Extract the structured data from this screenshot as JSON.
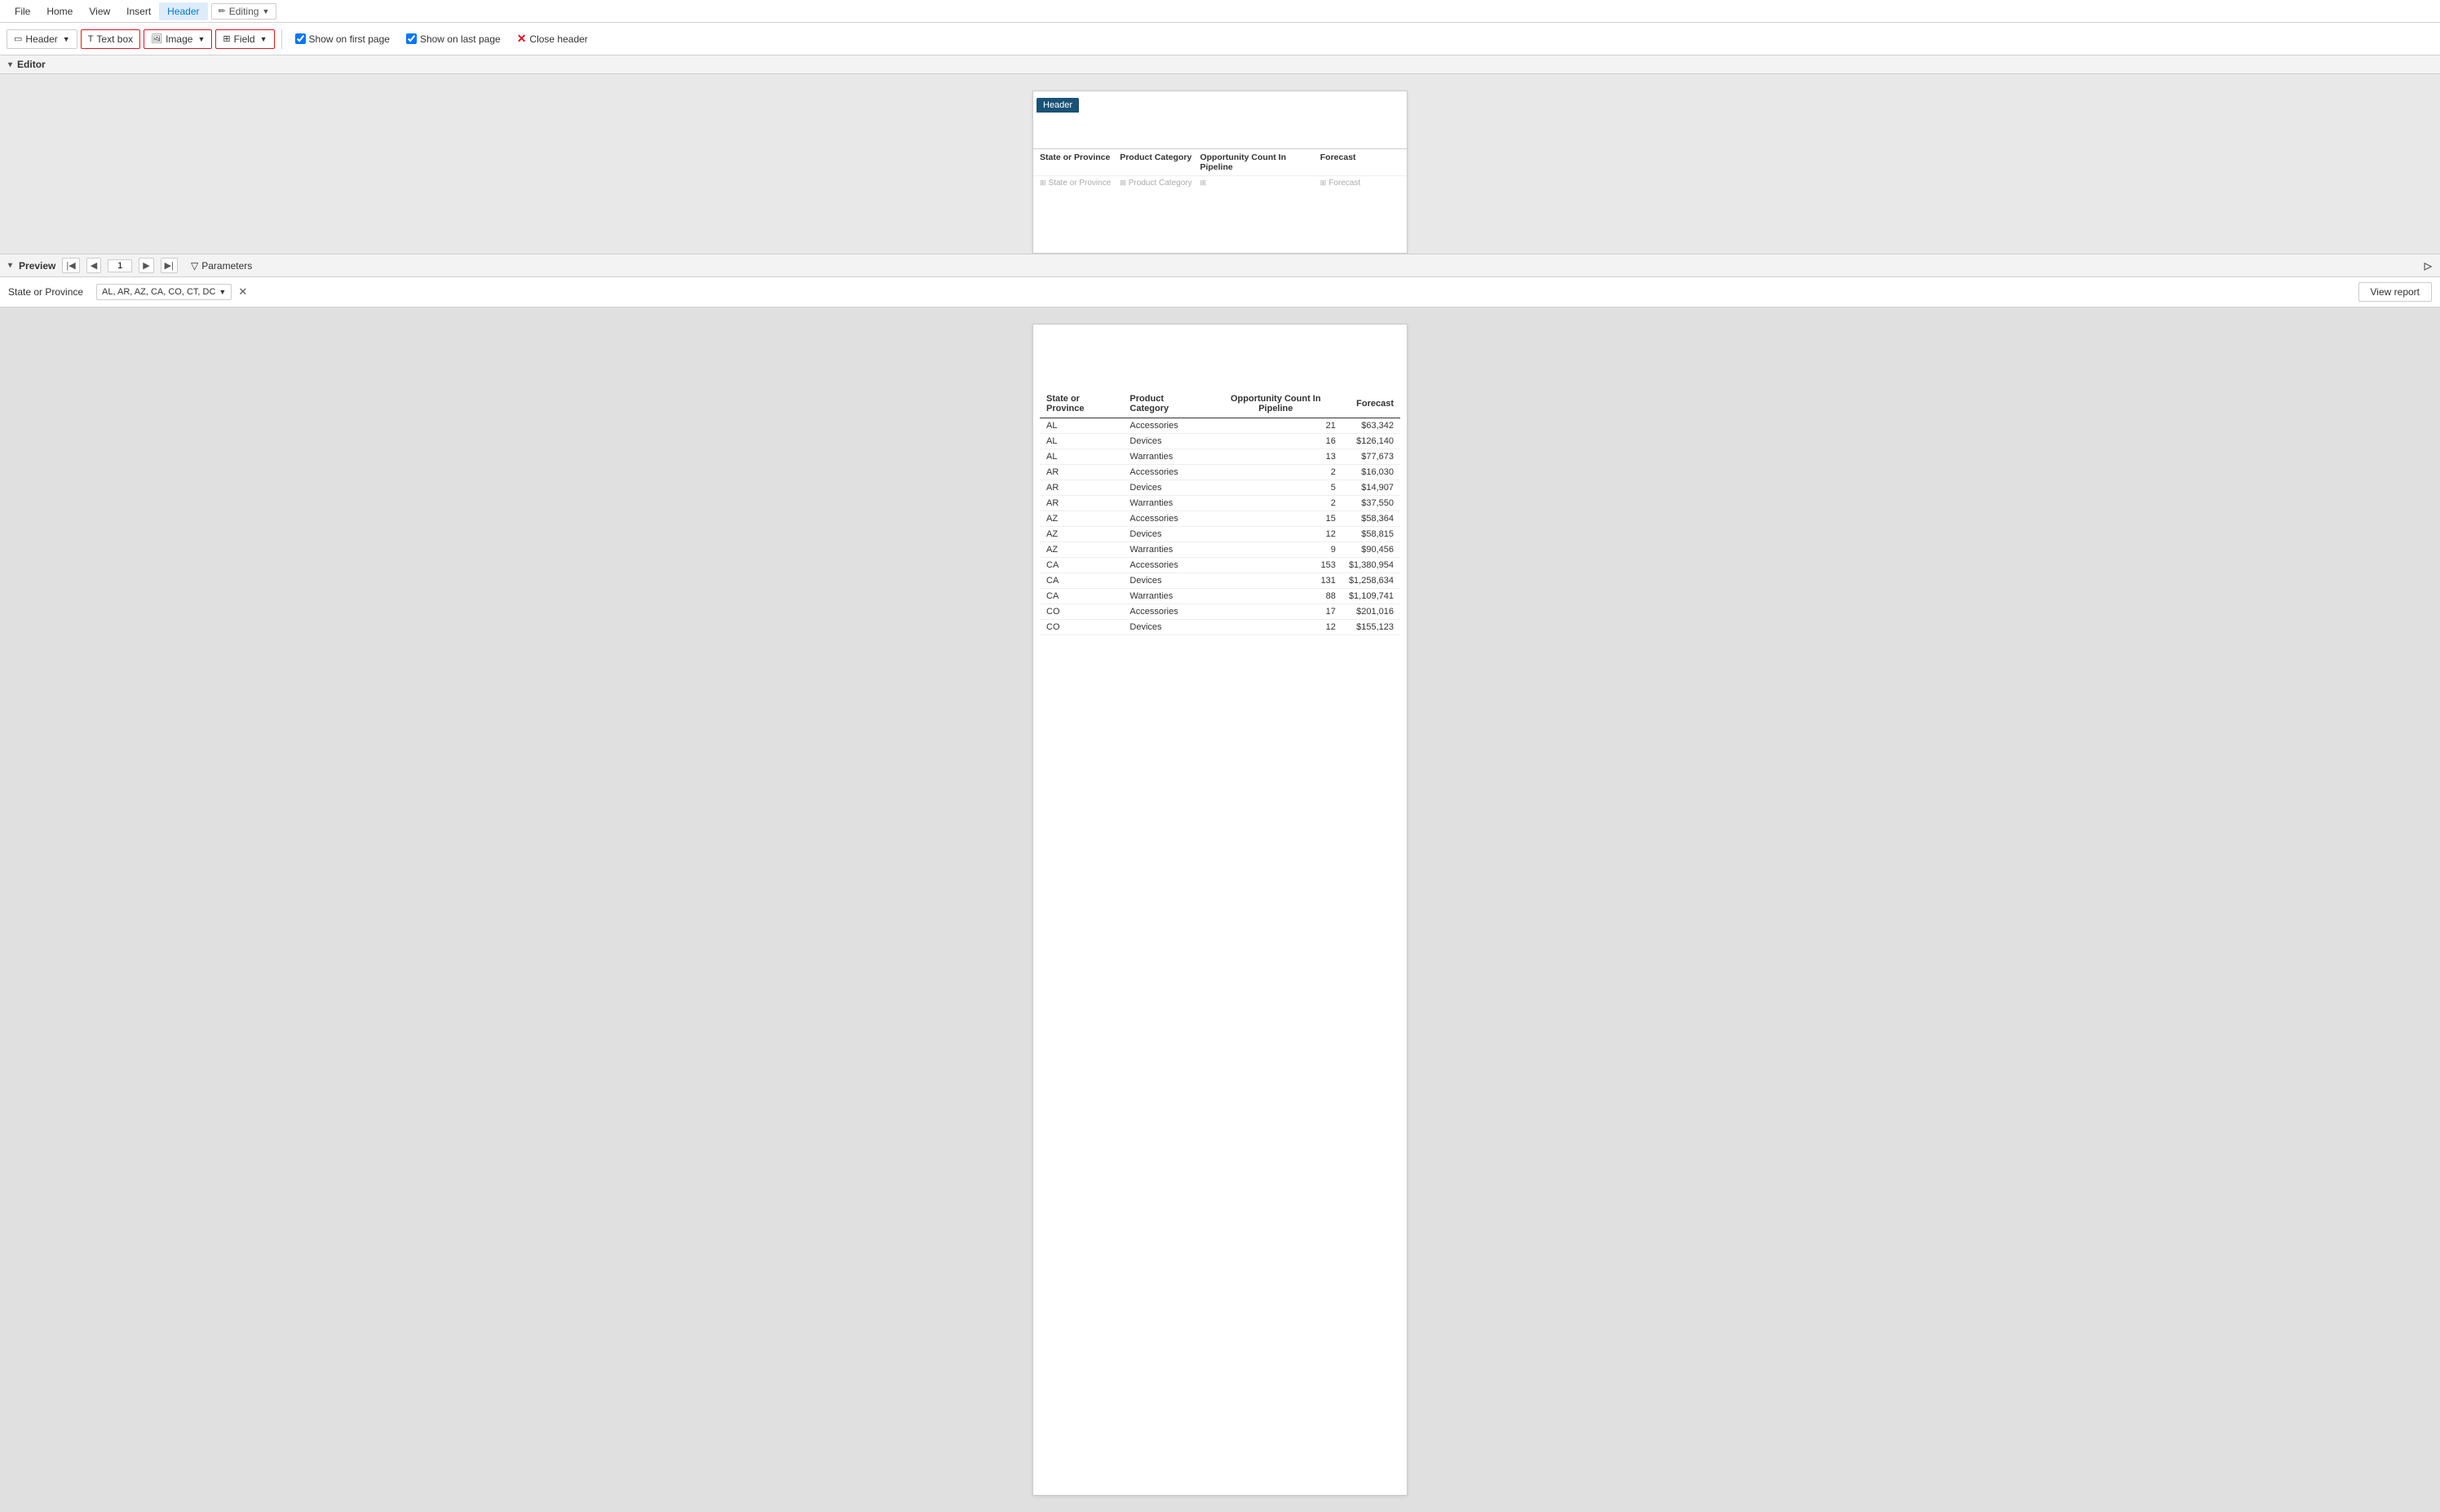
{
  "menuBar": {
    "items": [
      {
        "label": "File",
        "id": "file"
      },
      {
        "label": "Home",
        "id": "home"
      },
      {
        "label": "View",
        "id": "view"
      },
      {
        "label": "Insert",
        "id": "insert"
      },
      {
        "label": "Header",
        "id": "header",
        "active": true
      }
    ],
    "editing": {
      "label": "Editing",
      "icon": "pencil-icon"
    }
  },
  "toolbar": {
    "headerBtn": "Header",
    "textBoxBtn": "Text box",
    "imageBtn": "Image",
    "fieldBtn": "Field",
    "showOnFirstPage": "Show on first page",
    "showOnLastPage": "Show on last page",
    "closeHeader": "Close header"
  },
  "editor": {
    "label": "Editor",
    "reportHeader": {
      "headerTab": "Header",
      "columns": [
        {
          "label": "State or Province",
          "wide": false
        },
        {
          "label": "Product Category",
          "wide": false
        },
        {
          "label": "Opportunity Count In Pipeline",
          "wide": true
        },
        {
          "label": "Forecast",
          "wide": false
        }
      ],
      "dataRow": [
        {
          "text": "State or Province"
        },
        {
          "text": "Product Category"
        },
        {
          "text": ""
        },
        {
          "text": "Forecast"
        }
      ]
    }
  },
  "preview": {
    "label": "Preview",
    "pageNumber": "1",
    "parametersBtn": "Parameters",
    "parameter": {
      "label": "State or Province",
      "value": "AL, AR, AZ, CA, CO, CT, DC"
    },
    "viewReport": "View report",
    "tableColumns": [
      {
        "label": "State or Province"
      },
      {
        "label": "Product Category"
      },
      {
        "label": "Opportunity Count In Pipeline"
      },
      {
        "label": "Forecast"
      }
    ],
    "tableRows": [
      {
        "state": "AL",
        "category": "Accessories",
        "count": "21",
        "forecast": "$63,342"
      },
      {
        "state": "AL",
        "category": "Devices",
        "count": "16",
        "forecast": "$126,140"
      },
      {
        "state": "AL",
        "category": "Warranties",
        "count": "13",
        "forecast": "$77,673"
      },
      {
        "state": "AR",
        "category": "Accessories",
        "count": "2",
        "forecast": "$16,030"
      },
      {
        "state": "AR",
        "category": "Devices",
        "count": "5",
        "forecast": "$14,907"
      },
      {
        "state": "AR",
        "category": "Warranties",
        "count": "2",
        "forecast": "$37,550"
      },
      {
        "state": "AZ",
        "category": "Accessories",
        "count": "15",
        "forecast": "$58,364"
      },
      {
        "state": "AZ",
        "category": "Devices",
        "count": "12",
        "forecast": "$58,815"
      },
      {
        "state": "AZ",
        "category": "Warranties",
        "count": "9",
        "forecast": "$90,456"
      },
      {
        "state": "CA",
        "category": "Accessories",
        "count": "153",
        "forecast": "$1,380,954"
      },
      {
        "state": "CA",
        "category": "Devices",
        "count": "131",
        "forecast": "$1,258,634"
      },
      {
        "state": "CA",
        "category": "Warranties",
        "count": "88",
        "forecast": "$1,109,741"
      },
      {
        "state": "CO",
        "category": "Accessories",
        "count": "17",
        "forecast": "$201,016"
      },
      {
        "state": "CO",
        "category": "Devices",
        "count": "12",
        "forecast": "$155,123"
      }
    ]
  }
}
